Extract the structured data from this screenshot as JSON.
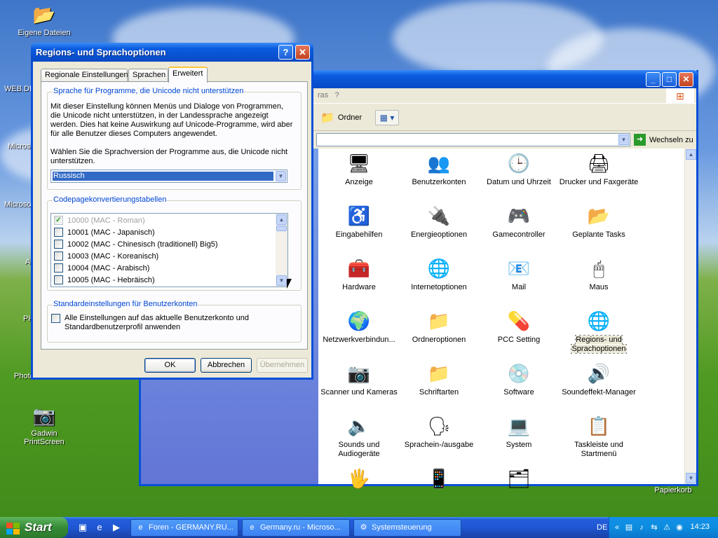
{
  "desktop": {
    "icons": [
      {
        "label": "Eigene Dateien",
        "icon": "my-documents-icon"
      },
      {
        "label": "Gadwin PrintScreen",
        "icon": "printscreen-icon"
      },
      {
        "label": "Papierkorb",
        "icon": "recycle-bin-icon"
      }
    ],
    "partial_labels": [
      "WEB.DE",
      "Microso",
      "Microso",
      "A",
      "PH",
      "Photo"
    ]
  },
  "explorer": {
    "menu_partial": "ras   ?",
    "toolbar_folder_label": "Ordner",
    "address_go_label": "Wechseln zu",
    "items": [
      {
        "label": "Anzeige",
        "icon": "display-icon"
      },
      {
        "label": "Benutzerkonten",
        "icon": "users-icon"
      },
      {
        "label": "Datum und Uhrzeit",
        "icon": "clock-icon"
      },
      {
        "label": "Drucker und Faxgeräte",
        "icon": "printer-icon"
      },
      {
        "label": "Eingabehilfen",
        "icon": "accessibility-icon"
      },
      {
        "label": "Energieoptionen",
        "icon": "power-icon"
      },
      {
        "label": "Gamecontroller",
        "icon": "gamepad-icon"
      },
      {
        "label": "Geplante Tasks",
        "icon": "scheduled-tasks-icon"
      },
      {
        "label": "Hardware",
        "icon": "hardware-icon"
      },
      {
        "label": "Internetoptionen",
        "icon": "internet-icon"
      },
      {
        "label": "Mail",
        "icon": "mail-icon"
      },
      {
        "label": "Maus",
        "icon": "mouse-icon"
      },
      {
        "label": "Netzwerkverbindun...",
        "icon": "network-icon"
      },
      {
        "label": "Ordneroptionen",
        "icon": "folder-options-icon"
      },
      {
        "label": "PCC Setting",
        "icon": "pcc-icon"
      },
      {
        "label": "Regions- und Sprachoptionen",
        "icon": "globe-icon"
      },
      {
        "label": "Scanner und Kameras",
        "icon": "scanner-icon"
      },
      {
        "label": "Schriftarten",
        "icon": "fonts-icon"
      },
      {
        "label": "Software",
        "icon": "software-icon"
      },
      {
        "label": "Soundeffekt-Manager",
        "icon": "sound-manager-icon"
      },
      {
        "label": "Sounds und Audiogeräte",
        "icon": "speaker-icon"
      },
      {
        "label": "Sprachein-/ausgabe",
        "icon": "speech-icon"
      },
      {
        "label": "System",
        "icon": "system-icon"
      },
      {
        "label": "Taskleiste und Startmenü",
        "icon": "taskbar-icon"
      }
    ]
  },
  "dialog": {
    "title": "Regions- und Sprachoptionen",
    "help_glyph": "?",
    "close_glyph": "✕",
    "tabs": [
      "Regionale Einstellungen",
      "Sprachen",
      "Erweitert"
    ],
    "unicode_group": {
      "title": "Sprache für Programme, die Unicode nicht unterstützen",
      "description": "Mit dieser Einstellung können Menüs und Dialoge von Programmen, die Unicode nicht unterstützen, in der Landessprache angezeigt werden. Dies hat keine Auswirkung auf Unicode-Programme, wird aber für alle Benutzer dieses Computers angewendet.",
      "prompt": "Wählen Sie die Sprachversion der Programme aus, die Unicode nicht unterstützen.",
      "selected_language": "Russisch"
    },
    "codepage_group": {
      "title": "Codepagekonvertierungstabellen",
      "rows": [
        {
          "label": "10000 (MAC - Roman)",
          "checked": true,
          "disabled": true
        },
        {
          "label": "10001 (MAC - Japanisch)",
          "checked": false,
          "disabled": false
        },
        {
          "label": "10002 (MAC - Chinesisch (traditionell) Big5)",
          "checked": false,
          "disabled": false
        },
        {
          "label": "10003 (MAC - Koreanisch)",
          "checked": false,
          "disabled": false
        },
        {
          "label": "10004 (MAC - Arabisch)",
          "checked": false,
          "disabled": false
        },
        {
          "label": "10005 (MAC - Hebräisch)",
          "checked": false,
          "disabled": false
        }
      ]
    },
    "defaults_group": {
      "title": "Standardeinstellungen für Benutzerkonten",
      "checkbox_label": "Alle Einstellungen auf das aktuelle Benutzerkonto und Standardbenutzerprofil anwenden"
    },
    "buttons": {
      "ok": "OK",
      "cancel": "Abbrechen",
      "apply": "Übernehmen"
    }
  },
  "taskbar": {
    "start_label": "Start",
    "tasks": [
      {
        "label": "Foren - GERMANY.RU...",
        "icon": "ie-icon"
      },
      {
        "label": "Germany.ru - Microso...",
        "icon": "ie-icon"
      },
      {
        "label": "Systemsteuerung",
        "icon": "control-panel-icon"
      }
    ],
    "language": "DE",
    "clock": "14:23"
  }
}
